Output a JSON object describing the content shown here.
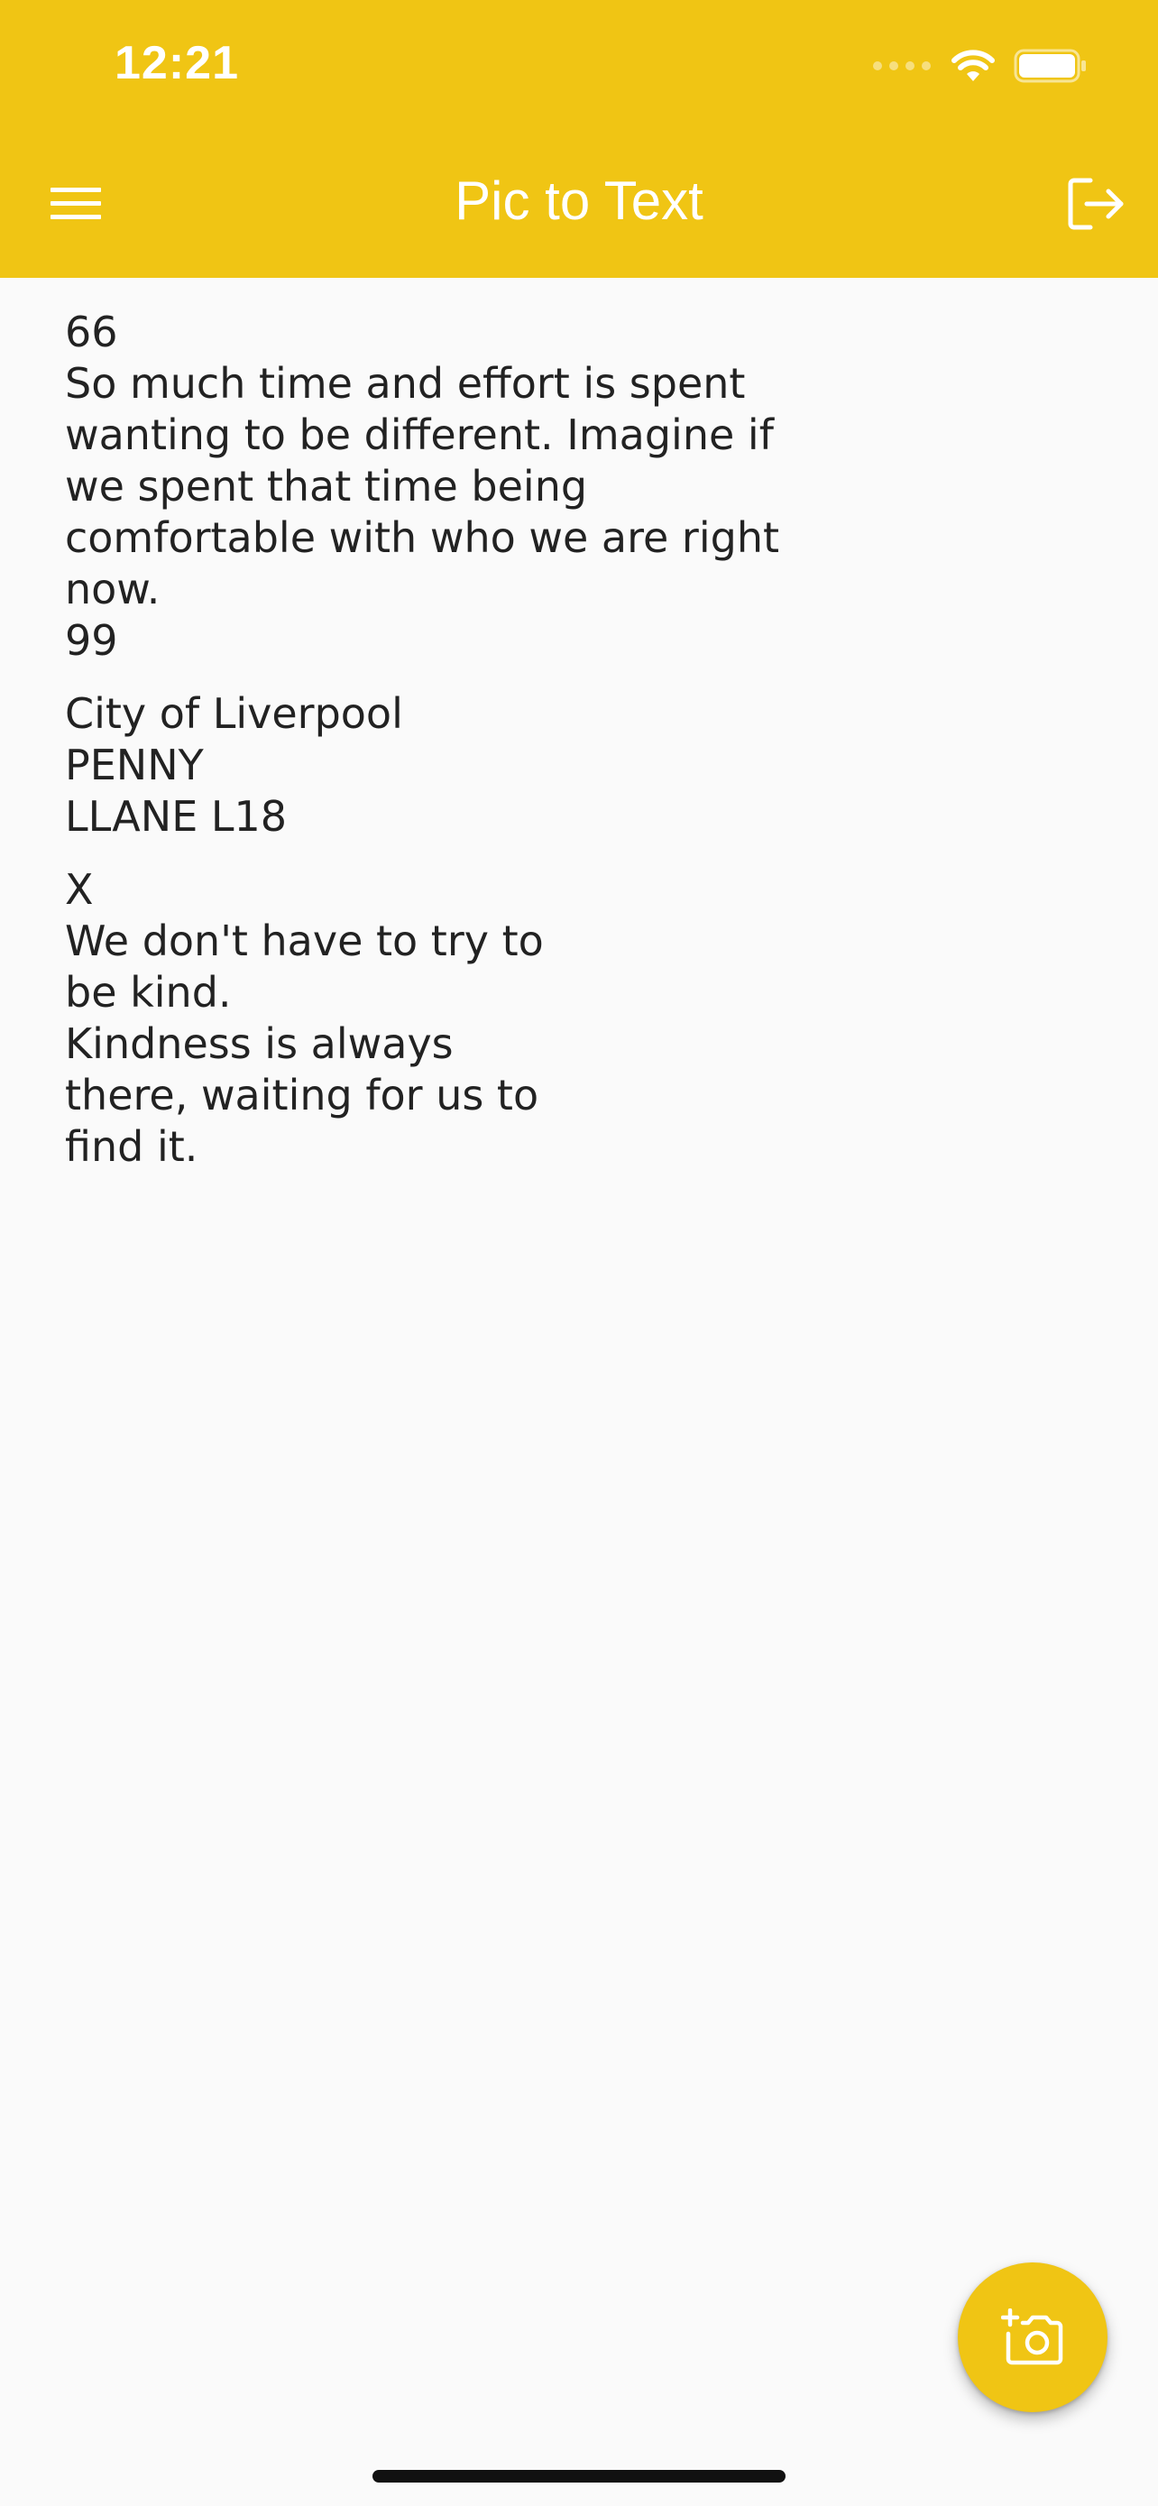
{
  "status_bar": {
    "time": "12:21"
  },
  "app_bar": {
    "title": "Pic to Text",
    "menu_icon": "hamburger-menu-icon",
    "logout_icon": "logout-icon"
  },
  "content": {
    "blocks": [
      "66\nSo much time and effort is spent\nwanting to be different. Imagine if\nwe spent that time being\ncomfortable with who we are right\nnow.\n99",
      "City of Liverpool\nPENNY\nLLANE L18",
      "X\nWe don't have to try to\nbe kind.\nKindness is always\nthere, waiting for us to\nfind it."
    ]
  },
  "fab": {
    "icon": "add-photo-camera-icon"
  },
  "colors": {
    "accent": "#f0c514",
    "background": "#fafafa",
    "text": "#222222",
    "on_accent": "#ffffff"
  }
}
